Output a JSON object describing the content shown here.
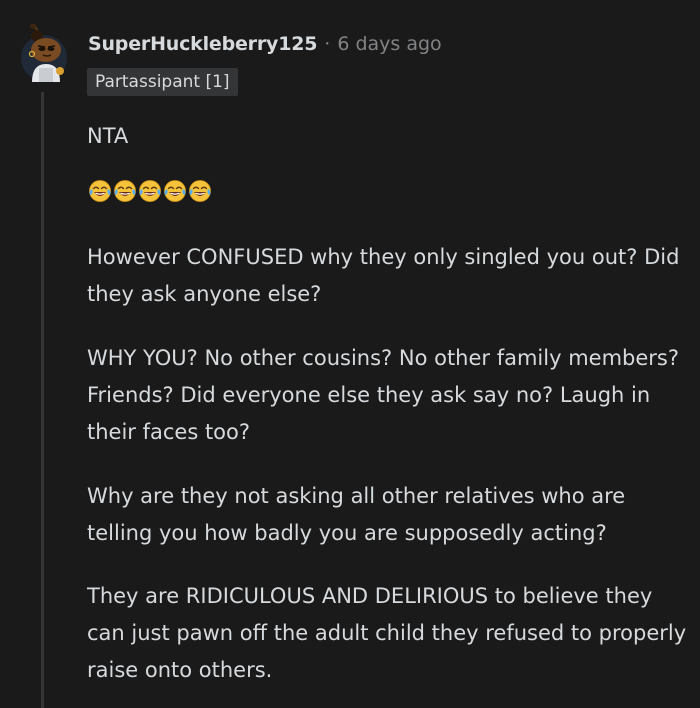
{
  "comment": {
    "username": "SuperHuckleberry125",
    "separator": "·",
    "timestamp": "6 days ago",
    "flair": "Partassipant [1]",
    "avatar_icon": "snoo-avatar-icon",
    "emoji_icon": "face-with-tears-of-joy-icon",
    "emoji_count": 5,
    "paragraphs": {
      "verdict": "NTA",
      "p1": "However CONFUSED why they only singled you out? Did they ask anyone else?",
      "p2": "WHY YOU? No other cousins? No other family members? Friends? Did everyone else they ask say no? Laugh in their faces too?",
      "p3": "Why are they not asking all other relatives who are telling you how badly you are supposedly acting?",
      "p4": "They are RIDICULOUS AND DELIRIOUS to believe they can just pawn off the adult child they refused to properly raise onto others."
    }
  },
  "colors": {
    "background": "#1a1a1b",
    "text": "#d7dadc",
    "muted": "#818384",
    "flair_bg": "#343536",
    "thread_line": "#343536"
  }
}
